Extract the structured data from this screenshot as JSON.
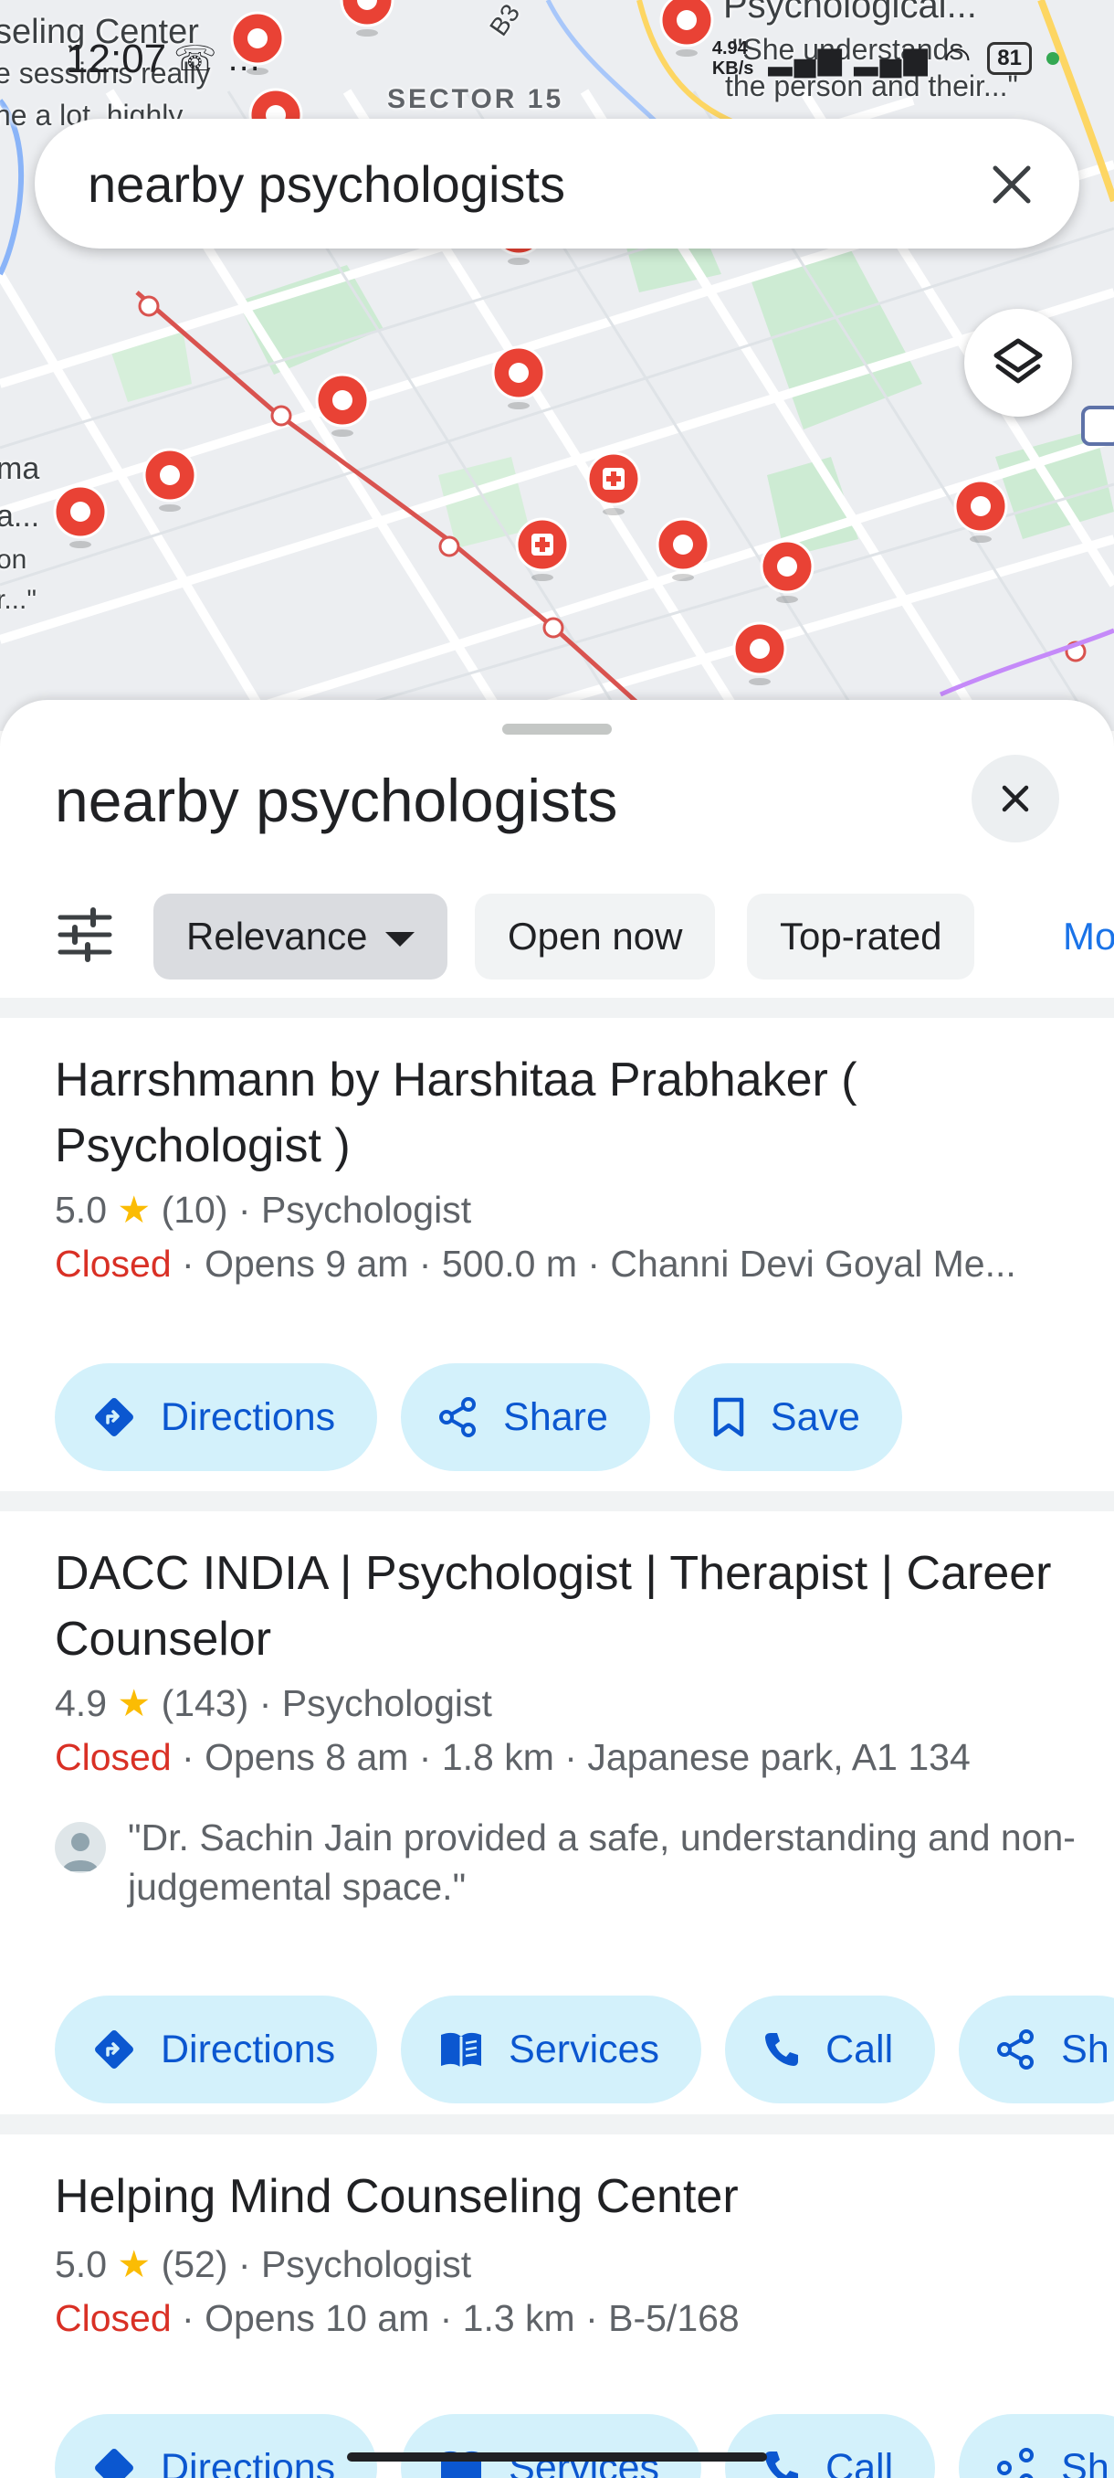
{
  "status_bar": {
    "time": "12:07",
    "icons": "☏ …",
    "speed_top": "4.94",
    "speed_unit": "KB/s",
    "battery": "81"
  },
  "map": {
    "labels": {
      "counseling_center": "seling Center",
      "review_top_left_1": "e sessions really",
      "review_top_left_2": "he a lot, highly",
      "sector": "SECTOR 15",
      "psychological": "Psychological...",
      "review_right_1": "\"She understands",
      "review_right_2": "the person and their...\"",
      "left_label_1": "ma",
      "left_label_2": "a...",
      "left_label_3": "on",
      "left_label_4": "r...\""
    },
    "road_label": "B3"
  },
  "search": {
    "query": "nearby psychologists"
  },
  "sheet": {
    "title": "nearby psychologists",
    "chips": {
      "relevance": "Relevance",
      "open_now": "Open now",
      "top_rated": "Top-rated",
      "more": "Mo"
    }
  },
  "results": [
    {
      "name": "Harrshmann by Harshitaa Prabhaker ( Psychologist )",
      "rating": "5.0",
      "reviews": "(10)",
      "category": "Psychologist",
      "status": "Closed",
      "details": "· Opens 9 am · 500.0 m · Channi Devi Goyal Me...",
      "actions": [
        "Directions",
        "Share",
        "Save"
      ]
    },
    {
      "name": "DACC INDIA | Psychologist | Therapist | Career Counselor",
      "rating": "4.9",
      "reviews": "(143)",
      "category": "Psychologist",
      "status": "Closed",
      "details": "· Opens 8 am · 1.8 km · Japanese park, A1 134",
      "quote": "\"Dr. Sachin Jain provided a safe, understanding and non-judgemental space.\"",
      "actions": [
        "Directions",
        "Services",
        "Call",
        "Sh"
      ]
    },
    {
      "name": "Helping Mind Counseling Center",
      "rating": "5.0",
      "reviews": "(52)",
      "category": "Psychologist",
      "status": "Closed",
      "details": "· Opens 10 am · 1.3 km · B-5/168",
      "actions": [
        "Directions",
        "Services",
        "Call",
        "Sh"
      ]
    }
  ],
  "colors": {
    "accent": "#0b57d0",
    "action_bg": "#d3f1fb",
    "closed": "#d93025",
    "star": "#fbbc04",
    "pin": "#e94235"
  }
}
